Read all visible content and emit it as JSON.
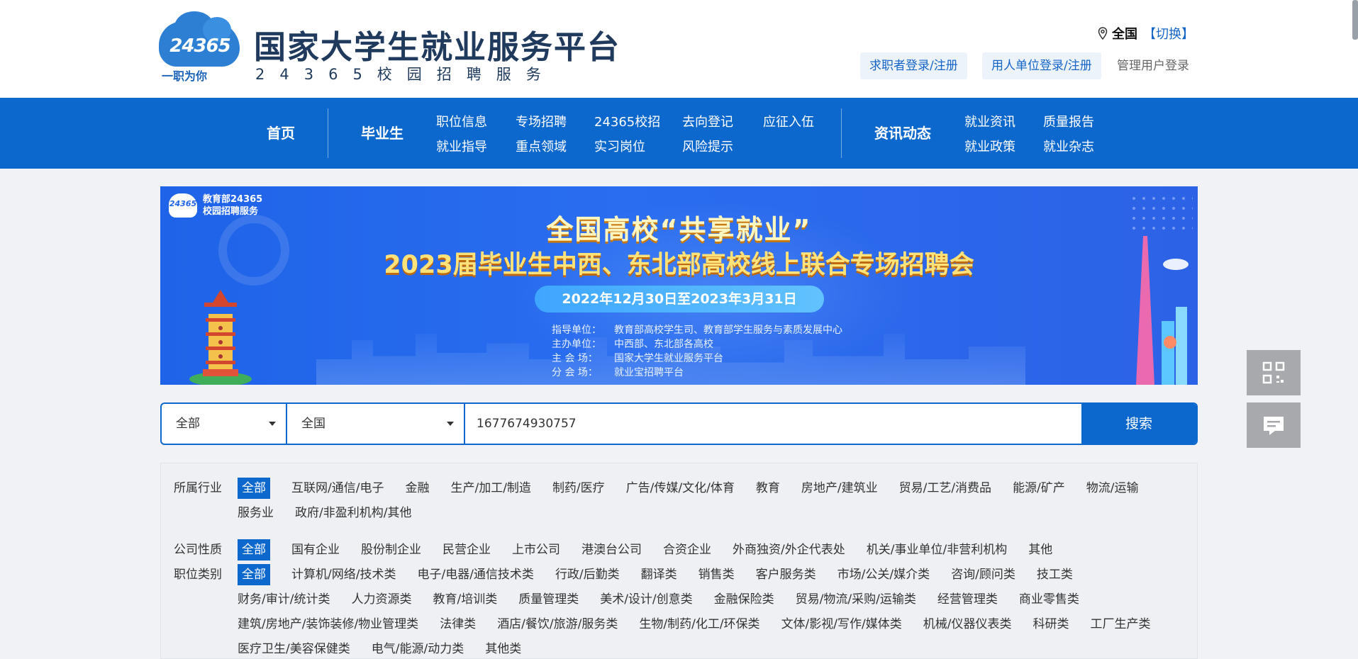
{
  "header": {
    "logo_number": "24365",
    "logo_slogan": "一职为你",
    "title": "国家大学生就业服务平台",
    "subtitle": "24365校园招聘服务",
    "region": "全国",
    "region_switch": "【切换】",
    "login_seeker": "求职者登录/注册",
    "login_employer": "用人单位登录/注册",
    "login_admin": "管理用户登录"
  },
  "nav": {
    "home": "首页",
    "graduate": "毕业生",
    "graduate_items": [
      [
        "职位信息",
        "专场招聘",
        "24365校招",
        "去向登记",
        "应征入伍"
      ],
      [
        "就业指导",
        "重点领域",
        "实习岗位",
        "风险提示"
      ]
    ],
    "news": "资讯动态",
    "news_items": [
      [
        "就业资讯",
        "质量报告"
      ],
      [
        "就业政策",
        "就业杂志"
      ]
    ]
  },
  "banner": {
    "brand_line1": "教育部24365",
    "brand_line2": "校园招聘服务",
    "brand_mini": "24365",
    "title1": "全国高校“共享就业”",
    "title2": "2023届毕业生中西、东北部高校线上联合专场招聘会",
    "date": "2022年12月30日至2023年3月31日",
    "info": [
      {
        "k": "指导单位：",
        "v": "教育部高校学生司、教育部学生服务与素质发展中心"
      },
      {
        "k": "主办单位：",
        "v": "中西部、东北部各高校"
      },
      {
        "k": "主 会 场：",
        "v": "国家大学生就业服务平台"
      },
      {
        "k": "分 会 场：",
        "v": "就业宝招聘平台"
      }
    ]
  },
  "search": {
    "category": "全部",
    "area": "全国",
    "query": "1677674930757",
    "button": "搜索"
  },
  "filters": [
    {
      "label": "所属行业",
      "items": [
        "全部",
        "互联网/通信/电子",
        "金融",
        "生产/加工/制造",
        "制药/医疗",
        "广告/传媒/文化/体育",
        "教育",
        "房地产/建筑业",
        "贸易/工艺/消费品",
        "能源/矿产",
        "物流/运输",
        "服务业",
        "政府/非盈利机构/其他"
      ]
    },
    {
      "label": "公司性质",
      "items": [
        "全部",
        "国有企业",
        "股份制企业",
        "民营企业",
        "上市公司",
        "港澳台公司",
        "合资企业",
        "外商独资/外企代表处",
        "机关/事业单位/非营利机构",
        "其他"
      ]
    },
    {
      "label": "职位类别",
      "items": [
        "全部",
        "计算机/网络/技术类",
        "电子/电器/通信技术类",
        "行政/后勤类",
        "翻译类",
        "销售类",
        "客户服务类",
        "市场/公关/媒介类",
        "咨询/顾问类",
        "技工类",
        "财务/审计/统计类",
        "人力资源类",
        "教育/培训类",
        "质量管理类",
        "美术/设计/创意类",
        "金融保险类",
        "贸易/物流/采购/运输类",
        "经营管理类",
        "商业零售类",
        "建筑/房地产/装饰装修/物业管理类",
        "法律类",
        "酒店/餐饮/旅游/服务类",
        "生物/制药/化工/环保类",
        "文体/影视/写作/媒体类",
        "机械/仪器仪表类",
        "科研类",
        "工厂生产类",
        "医疗卫生/美容保健类",
        "电气/能源/动力类",
        "其他类"
      ]
    }
  ],
  "floating": {
    "qr_icon": "qr-code-icon",
    "msg_icon": "message-icon"
  }
}
